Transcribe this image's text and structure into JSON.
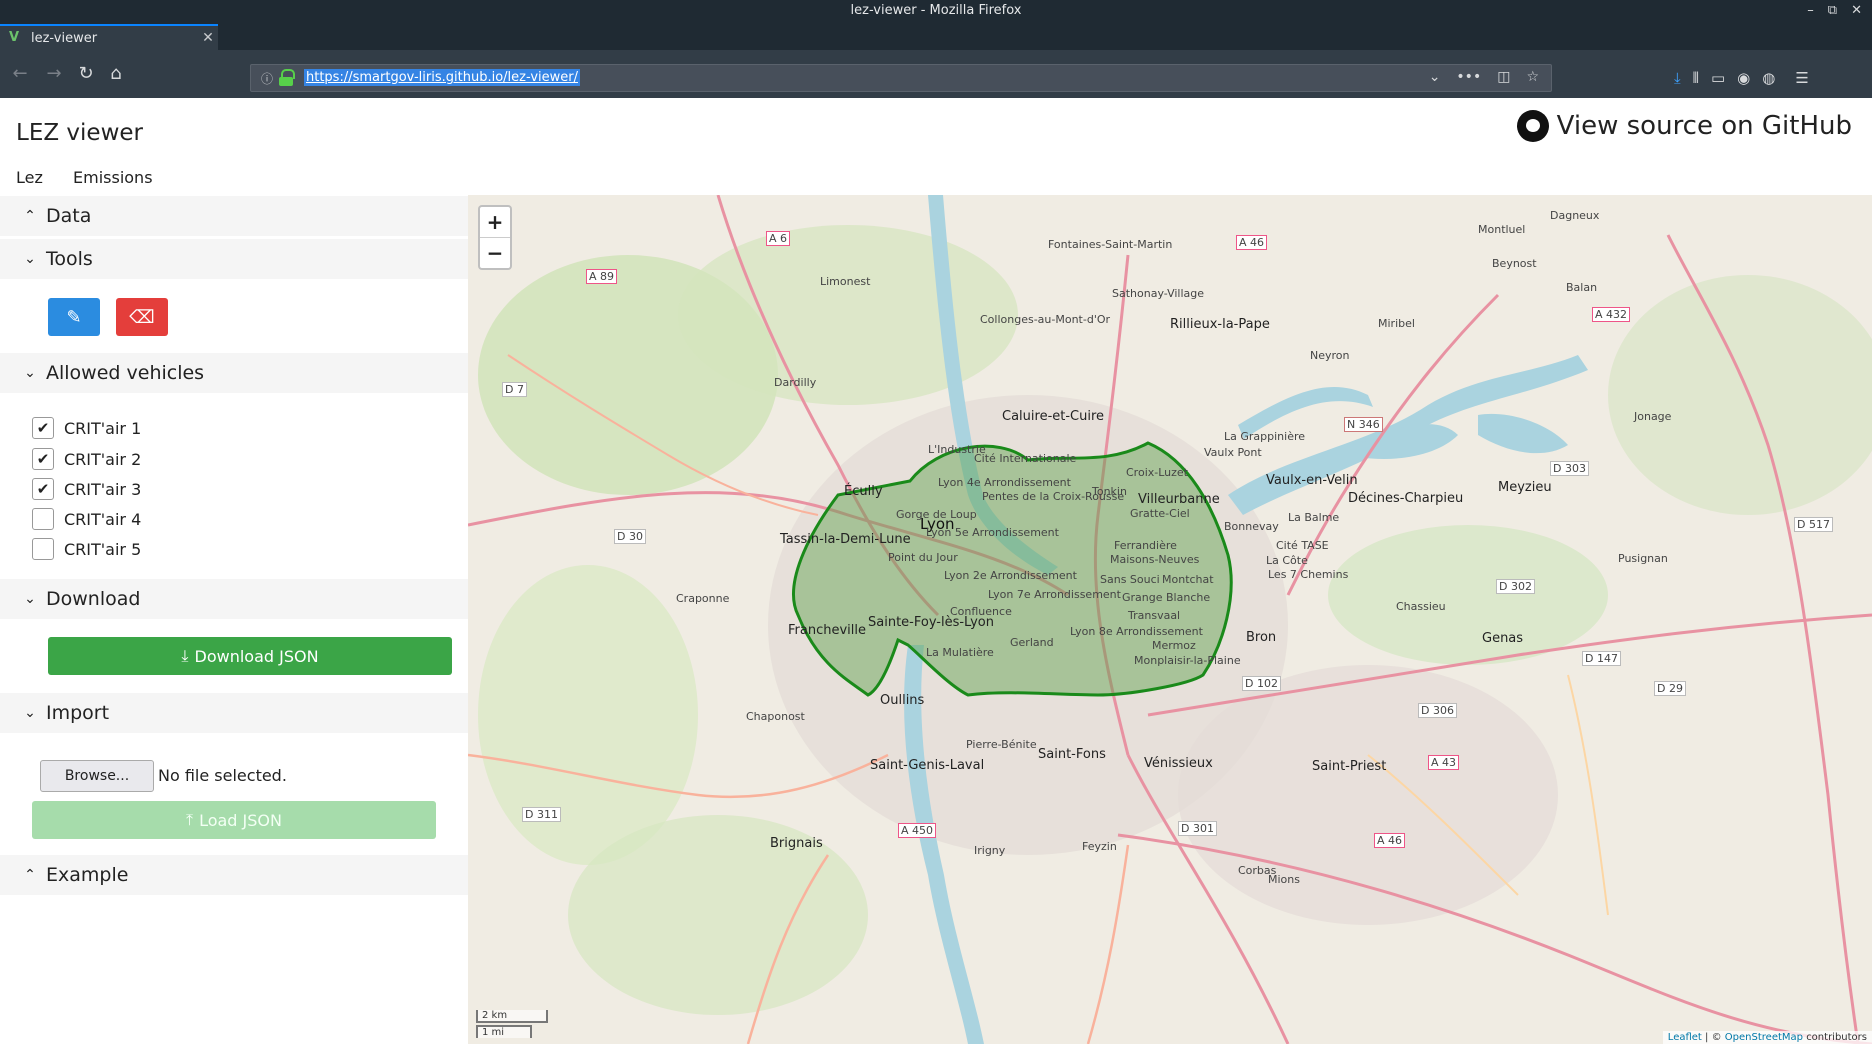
{
  "window": {
    "title": "lez-viewer - Mozilla Firefox",
    "controls": [
      "–",
      "⧉",
      "✕"
    ]
  },
  "tab": {
    "title": "lez-viewer",
    "close": "✕",
    "favicon": "V"
  },
  "newtab": "+",
  "url": "https://smartgov-liris.github.io/lez-viewer/",
  "app": {
    "title": "LEZ viewer",
    "github_link": "View source on GitHub"
  },
  "menu": [
    "Lez",
    "Emissions"
  ],
  "sections": {
    "data": "Data",
    "tools": "Tools",
    "allowed": "Allowed vehicles",
    "download": "Download",
    "import": "Import",
    "example": "Example"
  },
  "vehicles": [
    {
      "label": "CRIT'air 1",
      "checked": true
    },
    {
      "label": "CRIT'air 2",
      "checked": true
    },
    {
      "label": "CRIT'air 3",
      "checked": true
    },
    {
      "label": "CRIT'air 4",
      "checked": false
    },
    {
      "label": "CRIT'air 5",
      "checked": false
    }
  ],
  "buttons": {
    "download_json": "Download JSON",
    "browse": "Browse...",
    "no_file": "No file selected.",
    "load_json": "Load JSON"
  },
  "map": {
    "zoom_in": "+",
    "zoom_out": "−",
    "scale_km": "2 km",
    "scale_mi": "1 mi",
    "attribution_leaflet": "Leaflet",
    "attribution_osm": "OpenStreetMap",
    "attribution_sep": "| ©",
    "attribution_tail": "contributors",
    "zone_color": "#1a8a1a",
    "labels": {
      "lyon": "Lyon",
      "villeurbanne": "Villeurbanne",
      "caluire": "Caluire-et-Cuire",
      "rillieux": "Rillieux-la-Pape",
      "vaulx": "Vaulx-en-Velin",
      "decines": "Décines-Charpieu",
      "meyzieu": "Meyzieu",
      "bron": "Bron",
      "genas": "Genas",
      "venissieux": "Vénissieux",
      "stpriest": "Saint-Priest",
      "stfons": "Saint-Fons",
      "oullins": "Oullins",
      "ecully": "Écully",
      "tassin": "Tassin-la-Demi-Lune",
      "francheville": "Francheville",
      "stefoy": "Sainte-Foy-lès-Lyon",
      "stgenis": "Saint-Genis-Laval",
      "brignais": "Brignais",
      "feyzin": "Feyzin",
      "mions": "Mions",
      "cite": "Cité Internationale",
      "croixluzet": "Croix-Luzet",
      "tonkin": "Tonkin",
      "lyon4": "Lyon 4e Arrondissement",
      "lyon5": "Lyon 5e Arrondissement",
      "lyon2": "Lyon 2e Arrondissement",
      "lyon7": "Lyon 7e Arrondissement",
      "lyon8": "Lyon 8e Arrondissement",
      "gerland": "Gerland",
      "confluence": "Confluence",
      "pointdujour": "Point du Jour",
      "gorge": "Gorge de Loup",
      "pentes": "Pentes de la Croix-Rousse",
      "grattciel": "Gratte-Ciel",
      "ferrandiere": "Ferrandière",
      "maisonsneuves": "Maisons-Neuves",
      "sanssouci": "Sans Souci",
      "montchat": "Montchat",
      "grangeblanche": "Grange Blanche",
      "transvaal": "Transvaal",
      "mermoz": "Mermoz",
      "montplaisir": "Monplaisir-la-Plaine",
      "lamulatiere": "La Mulatière",
      "craponne": "Craponne",
      "chaponost": "Chaponost",
      "dardilly": "Dardilly",
      "limonest": "Limonest",
      "neyron": "Neyron",
      "miribel": "Miribel",
      "jonage": "Jonage",
      "chassieu": "Chassieu",
      "pusignan": "Pusignan",
      "lagrappiniere": "La Grappinière",
      "vaulxpont": "Vaulx Pont",
      "labalme": "La Balme",
      "citetase": "Cité TASE",
      "lacote": "La Côte",
      "les7": "Les 7 Chemins",
      "bonnevay": "Bonnevay",
      "corbas": "Corbas",
      "irigny": "Irigny",
      "pierrebenite": "Pierre-Bénite",
      "fontaines": "Fontaines-Saint-Martin",
      "sathonay": "Sathonay-Village",
      "collonges": "Collonges-au-Mont-d'Or",
      "dagneux": "Dagneux",
      "beynost": "Beynost",
      "balan": "Balan",
      "montluel": "Montluel",
      "lyonindustrie": "L'Industrie"
    },
    "roads": {
      "a46n": "A 46",
      "a6": "A 6",
      "a89": "A 89",
      "a432": "A 432",
      "n346": "N 346",
      "d303": "D 303",
      "d517": "D 517",
      "d302": "D 302",
      "d147": "D 147",
      "d29": "D 29",
      "d306": "D 306",
      "a43": "A 43",
      "d102": "D 102",
      "d301": "D 301",
      "a450": "A 450",
      "a46s": "A 46",
      "d311": "D 311",
      "d30": "D 30",
      "d7": "D 7"
    }
  }
}
